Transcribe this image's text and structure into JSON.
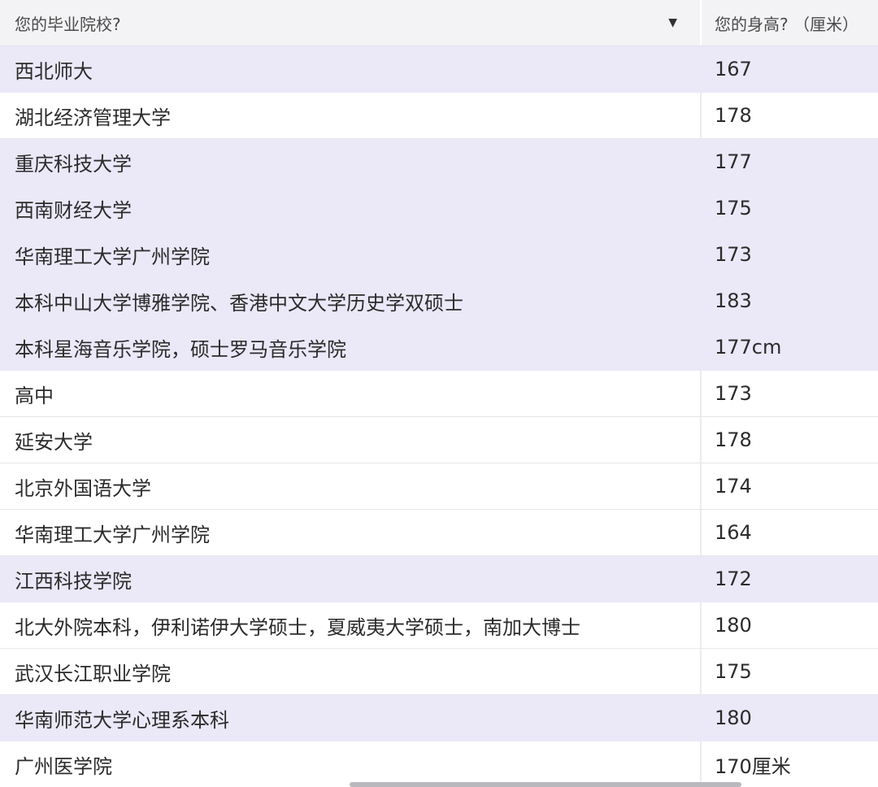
{
  "table": {
    "headers": {
      "school": "您的毕业院校?",
      "height": "您的身高? （厘米）"
    },
    "sort_icon": "caret-down-icon",
    "highlight_color": "#ebe8f8",
    "rows": [
      {
        "school": "西北师大",
        "height": "167",
        "highlighted": true
      },
      {
        "school": "湖北经济管理大学",
        "height": "178",
        "highlighted": false
      },
      {
        "school": "重庆科技大学",
        "height": "177",
        "highlighted": true
      },
      {
        "school": "西南财经大学",
        "height": "175",
        "highlighted": true
      },
      {
        "school": "华南理工大学广州学院",
        "height": "173",
        "highlighted": true
      },
      {
        "school": "本科中山大学博雅学院、香港中文大学历史学双硕士",
        "height": "183",
        "highlighted": true
      },
      {
        "school": "本科星海音乐学院，硕士罗马音乐学院",
        "height": "177cm",
        "highlighted": true
      },
      {
        "school": "高中",
        "height": "173",
        "highlighted": false
      },
      {
        "school": "延安大学",
        "height": "178",
        "highlighted": false
      },
      {
        "school": "北京外国语大学",
        "height": "174",
        "highlighted": false
      },
      {
        "school": "华南理工大学广州学院",
        "height": "164",
        "highlighted": false
      },
      {
        "school": "江西科技学院",
        "height": "172",
        "highlighted": true
      },
      {
        "school": "北大外院本科，伊利诺伊大学硕士，夏威夷大学硕士，南加大博士",
        "height": "180",
        "highlighted": false
      },
      {
        "school": "武汉长江职业学院",
        "height": "175",
        "highlighted": false
      },
      {
        "school": "华南师范大学心理系本科",
        "height": "180",
        "highlighted": true
      },
      {
        "school": "广州医学院",
        "height": "170厘米",
        "highlighted": false
      }
    ]
  }
}
